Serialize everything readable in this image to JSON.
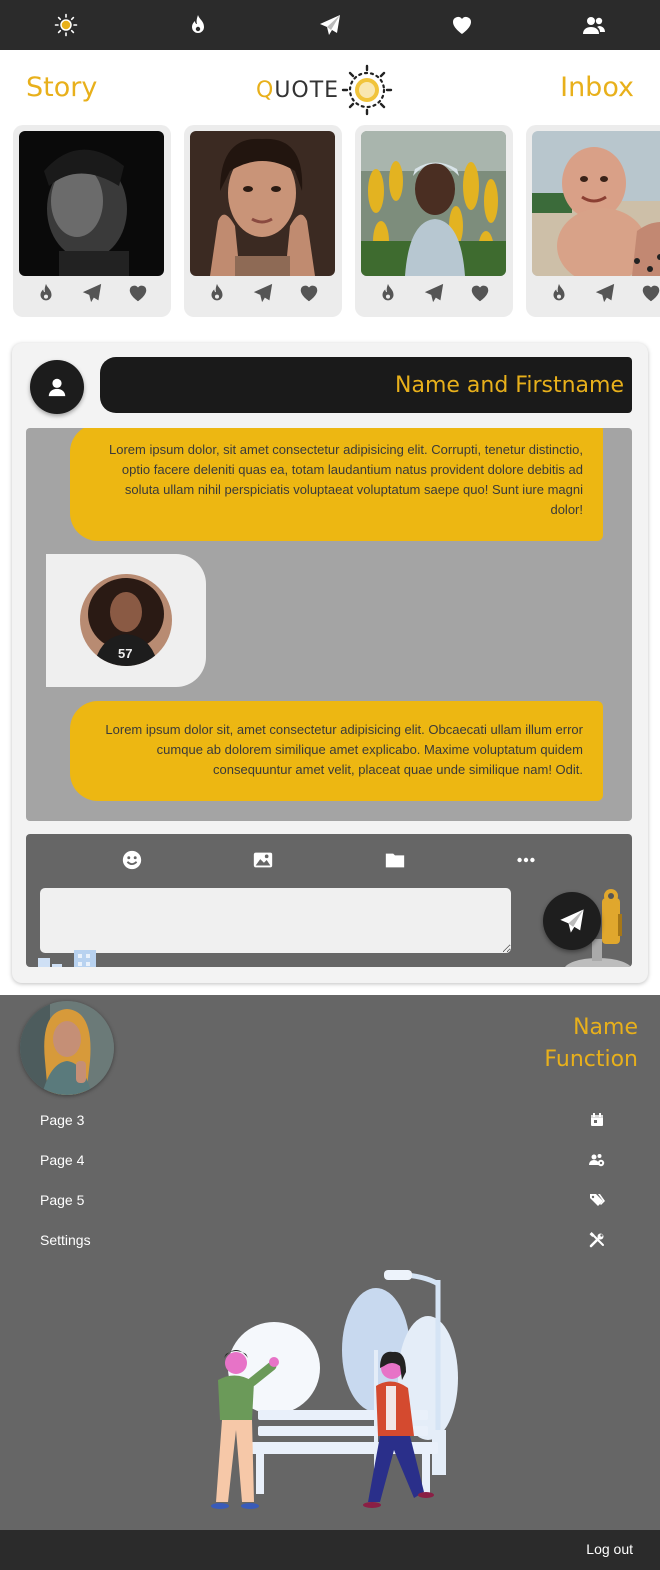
{
  "topnav": {
    "items": [
      {
        "icon": "sun-icon"
      },
      {
        "icon": "flame-icon"
      },
      {
        "icon": "paper-plane-icon"
      },
      {
        "icon": "heart-icon"
      },
      {
        "icon": "users-icon"
      }
    ]
  },
  "header": {
    "story": "Story",
    "inbox": "Inbox",
    "logo_q": "Q",
    "logo_rest": "UOTE"
  },
  "stories": [
    {
      "photo": "man-dark-portrait"
    },
    {
      "photo": "woman-hands-face"
    },
    {
      "photo": "woman-yellow-flowers"
    },
    {
      "photo": "baby-beach"
    }
  ],
  "chat": {
    "contact_name": "Name and Firstname",
    "messages": [
      {
        "type": "text",
        "text": "Lorem ipsum dolor, sit amet consectetur adipisicing elit. Corrupti, tenetur distinctio, optio facere deleniti quas ea, totam laudantium natus provident dolore debitis ad soluta ullam nihil perspiciatis voluptaeat voluptatum saepe quo! Sunt iure magni dolor!"
      },
      {
        "type": "image",
        "photo": "woman-curly-hair-57"
      },
      {
        "type": "text",
        "text": "Lorem ipsum dolor sit, amet consectetur adipisicing elit. Obcaecati ullam illum error cumque ab dolorem similique amet explicabo. Maxime voluptatum quidem consequuntur amet velit, placeat quae unde similique nam! Odit."
      }
    ],
    "composer": {
      "tools": [
        "smile-icon",
        "image-icon",
        "folder-icon",
        "more-icon"
      ],
      "input_value": "",
      "input_placeholder": ""
    }
  },
  "profile": {
    "name": "Name",
    "function": "Function",
    "menu": [
      {
        "label": "Page 3",
        "icon": "calendar-icon"
      },
      {
        "label": "Page 4",
        "icon": "users-cog-icon"
      },
      {
        "label": "Page 5",
        "icon": "tags-icon"
      },
      {
        "label": "Settings",
        "icon": "tools-icon"
      }
    ]
  },
  "footer": {
    "logout": "Log out"
  },
  "colors": {
    "accent": "#e8b01b",
    "bubble": "#edb712",
    "dark": "#2b2b2b",
    "panel": "#666666"
  }
}
